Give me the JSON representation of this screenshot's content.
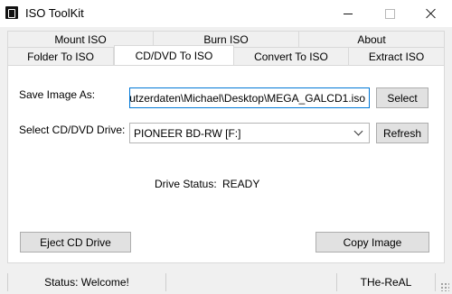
{
  "window": {
    "title": "ISO ToolKit"
  },
  "tabs": {
    "row_top": [
      "Mount ISO",
      "Burn ISO",
      "About"
    ],
    "row_bottom": [
      "Folder To ISO",
      "CD/DVD To ISO",
      "Convert To ISO",
      "Extract ISO"
    ],
    "active": "CD/DVD To ISO"
  },
  "panel": {
    "save_label": "Save Image As:",
    "save_value": "utzerdaten\\Michael\\Desktop\\MEGA_GALCD1.iso",
    "select_button": "Select",
    "drive_label": "Select CD/DVD Drive:",
    "drive_value": "PIONEER BD-RW  [F:]",
    "refresh_button": "Refresh",
    "status_label": "Drive Status:",
    "status_value": "READY",
    "eject_button": "Eject CD Drive",
    "copy_button": "Copy Image"
  },
  "statusbar": {
    "status": "Status: Welcome!",
    "credit": "THe-ReAL"
  },
  "icons": {
    "app": "app-icon",
    "minimize": "minimize-icon",
    "maximize": "maximize-icon",
    "close": "close-icon",
    "dropdown": "chevron-down-icon"
  }
}
